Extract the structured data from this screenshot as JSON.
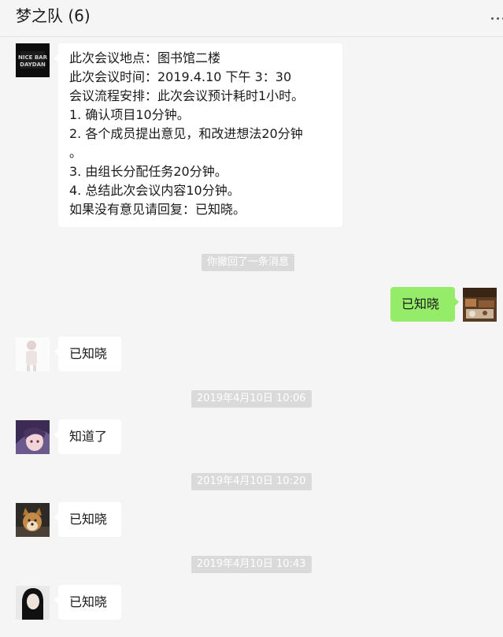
{
  "header": {
    "title": "梦之队 (6)"
  },
  "messages": {
    "m1": {
      "avatar_text": "NICE BAR DAYDAN",
      "lines": [
        "此次会议地点：图书馆二楼",
        "此次会议时间：2019.4.10 下午 3：30",
        "会议流程安排：此次会议预计耗时1小时。",
        "1. 确认项目10分钟。",
        "2. 各个成员提出意见，和改进想法20分钟",
        "。",
        "3. 由组长分配任务20分钟。",
        "4. 总结此次会议内容10分钟。",
        "如果没有意见请回复：已知晓。"
      ]
    },
    "recall_notice": "你撤回了一条消息",
    "m2": {
      "text": "已知晓"
    },
    "m3": {
      "text": "已知晓"
    },
    "time1": "2019年4月10日 10:06",
    "m4": {
      "text": "知道了"
    },
    "time2": "2019年4月10日 10:20",
    "m5": {
      "text": "已知晓"
    },
    "time3": "2019年4月10日 10:43",
    "m6": {
      "text": "已知晓"
    }
  },
  "colors": {
    "background": "#f5f5f5",
    "self_bubble": "#95ec69",
    "other_bubble": "#ffffff",
    "system_label": "#dadada"
  }
}
